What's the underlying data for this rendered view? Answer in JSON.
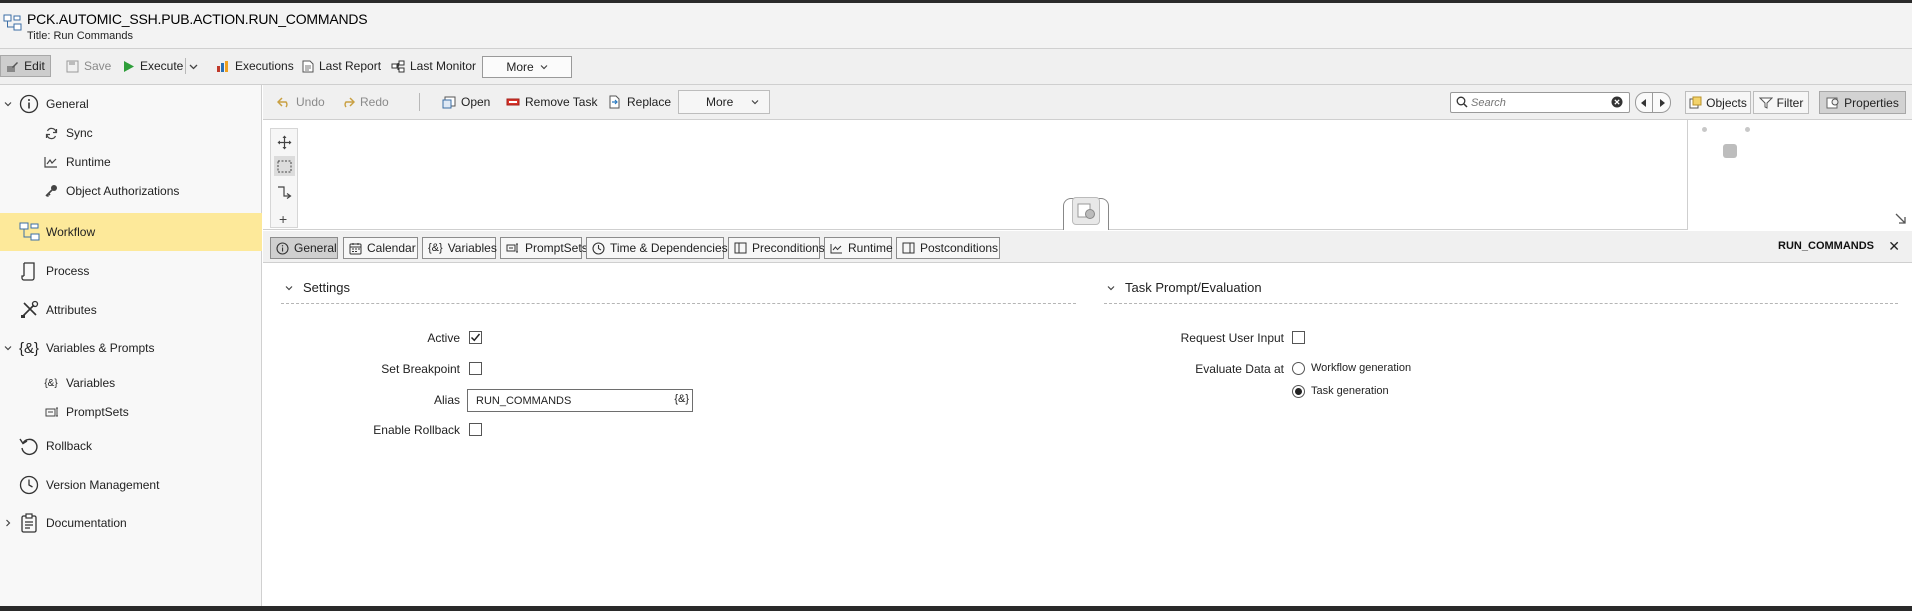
{
  "header": {
    "object_name": "PCK.AUTOMIC_SSH.PUB.ACTION.RUN_COMMANDS",
    "title_line": "Title: Run Commands"
  },
  "toolbar": {
    "edit": "Edit",
    "save": "Save",
    "execute": "Execute",
    "executions": "Executions",
    "last_report": "Last Report",
    "last_monitor": "Last Monitor",
    "more": "More"
  },
  "sidebar": {
    "items": [
      {
        "label": "General",
        "icon": "info-circle-icon"
      },
      {
        "label": "Sync",
        "icon": "sync-icon"
      },
      {
        "label": "Runtime",
        "icon": "runtime-chart-icon"
      },
      {
        "label": "Object Authorizations",
        "icon": "key-icon"
      },
      {
        "label": "Workflow",
        "icon": "workflow-icon"
      },
      {
        "label": "Process",
        "icon": "process-icon"
      },
      {
        "label": "Attributes",
        "icon": "attributes-icon"
      },
      {
        "label": "Variables & Prompts",
        "icon": "variables-icon"
      },
      {
        "label": "Variables",
        "icon": "variables-icon"
      },
      {
        "label": "PromptSets",
        "icon": "promptsets-icon"
      },
      {
        "label": "Rollback",
        "icon": "rollback-icon"
      },
      {
        "label": "Version Management",
        "icon": "clock-icon"
      },
      {
        "label": "Documentation",
        "icon": "documentation-icon"
      }
    ],
    "selected": "Workflow",
    "selected_color": "#fde99a"
  },
  "editor_toolbar": {
    "undo": "Undo",
    "redo": "Redo",
    "open": "Open",
    "remove_task": "Remove Task",
    "replace": "Replace",
    "more": "More",
    "search_placeholder": "Search",
    "objects": "Objects",
    "filter": "Filter",
    "properties": "Properties"
  },
  "tabs": {
    "items": [
      "General",
      "Calendar",
      "Variables",
      "PromptSets",
      "Time & Dependencies",
      "Preconditions",
      "Runtime",
      "Postconditions"
    ],
    "active": "General",
    "task_name": "RUN_COMMANDS"
  },
  "settings": {
    "title": "Settings",
    "active_label": "Active",
    "active_checked": true,
    "breakpoint_label": "Set Breakpoint",
    "breakpoint_checked": false,
    "alias_label": "Alias",
    "alias_value": "RUN_COMMANDS",
    "alias_button": "{&}",
    "rollback_label": "Enable Rollback",
    "rollback_checked": false
  },
  "task_prompt": {
    "title": "Task Prompt/Evaluation",
    "request_label": "Request User Input",
    "request_checked": false,
    "evaluate_label": "Evaluate Data at",
    "options": [
      "Workflow generation",
      "Task generation"
    ],
    "selected_option": "Task generation"
  }
}
